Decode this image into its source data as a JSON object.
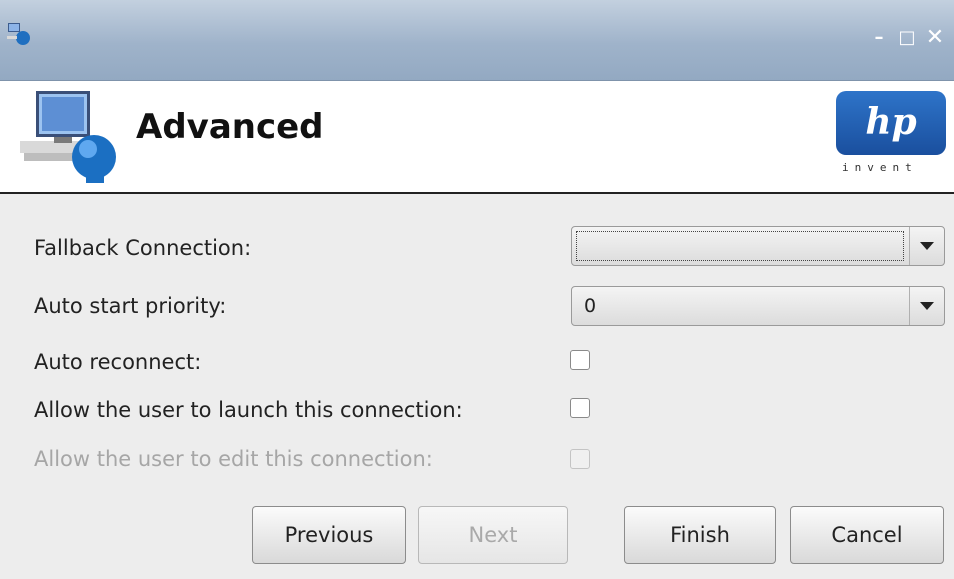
{
  "window": {
    "minimize_glyph": "–",
    "maximize_glyph": "□",
    "close_glyph": "✕"
  },
  "header": {
    "title": "Advanced",
    "logo_text": "hp",
    "logo_tagline": "invent",
    "colors": {
      "logo_blue": "#1f5fb3"
    }
  },
  "form": {
    "fallback_connection": {
      "label": "Fallback Connection:",
      "value": ""
    },
    "auto_start_priority": {
      "label": "Auto start priority:",
      "value": "0"
    },
    "auto_reconnect": {
      "label": "Auto reconnect:",
      "checked": false
    },
    "allow_launch": {
      "label": "Allow the user to launch this connection:",
      "checked": false
    },
    "allow_edit": {
      "label": "Allow the user to edit this connection:",
      "checked": false,
      "disabled": true
    }
  },
  "buttons": {
    "previous": "Previous",
    "next": "Next",
    "finish": "Finish",
    "cancel": "Cancel"
  }
}
